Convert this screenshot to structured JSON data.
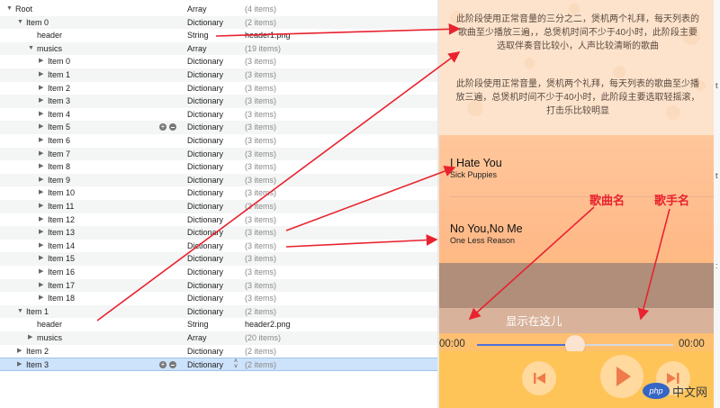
{
  "plist": {
    "rows": [
      {
        "key": "Root",
        "indent": 0,
        "disclosure": "open",
        "type": "Array",
        "value": "(4 items)"
      },
      {
        "key": "Item 0",
        "indent": 1,
        "disclosure": "open",
        "type": "Dictionary",
        "value": "(2 items)"
      },
      {
        "key": "header",
        "indent": 2,
        "disclosure": "none",
        "type": "String",
        "value": "header1.png"
      },
      {
        "key": "musics",
        "indent": 2,
        "disclosure": "open",
        "type": "Array",
        "value": "(19 items)"
      },
      {
        "key": "Item 0",
        "indent": 3,
        "disclosure": "closed",
        "type": "Dictionary",
        "value": "(3 items)"
      },
      {
        "key": "Item 1",
        "indent": 3,
        "disclosure": "closed",
        "type": "Dictionary",
        "value": "(3 items)"
      },
      {
        "key": "Item 2",
        "indent": 3,
        "disclosure": "closed",
        "type": "Dictionary",
        "value": "(3 items)"
      },
      {
        "key": "Item 3",
        "indent": 3,
        "disclosure": "closed",
        "type": "Dictionary",
        "value": "(3 items)"
      },
      {
        "key": "Item 4",
        "indent": 3,
        "disclosure": "closed",
        "type": "Dictionary",
        "value": "(3 items)"
      },
      {
        "key": "Item 5",
        "indent": 3,
        "disclosure": "closed",
        "type": "Dictionary",
        "value": "(3 items)",
        "controls": true
      },
      {
        "key": "Item 6",
        "indent": 3,
        "disclosure": "closed",
        "type": "Dictionary",
        "value": "(3 items)"
      },
      {
        "key": "Item 7",
        "indent": 3,
        "disclosure": "closed",
        "type": "Dictionary",
        "value": "(3 items)"
      },
      {
        "key": "Item 8",
        "indent": 3,
        "disclosure": "closed",
        "type": "Dictionary",
        "value": "(3 items)"
      },
      {
        "key": "Item 9",
        "indent": 3,
        "disclosure": "closed",
        "type": "Dictionary",
        "value": "(3 items)"
      },
      {
        "key": "Item 10",
        "indent": 3,
        "disclosure": "closed",
        "type": "Dictionary",
        "value": "(3 items)"
      },
      {
        "key": "Item 11",
        "indent": 3,
        "disclosure": "closed",
        "type": "Dictionary",
        "value": "(3 items)"
      },
      {
        "key": "Item 12",
        "indent": 3,
        "disclosure": "closed",
        "type": "Dictionary",
        "value": "(3 items)"
      },
      {
        "key": "Item 13",
        "indent": 3,
        "disclosure": "closed",
        "type": "Dictionary",
        "value": "(3 items)"
      },
      {
        "key": "Item 14",
        "indent": 3,
        "disclosure": "closed",
        "type": "Dictionary",
        "value": "(3 items)"
      },
      {
        "key": "Item 15",
        "indent": 3,
        "disclosure": "closed",
        "type": "Dictionary",
        "value": "(3 items)"
      },
      {
        "key": "Item 16",
        "indent": 3,
        "disclosure": "closed",
        "type": "Dictionary",
        "value": "(3 items)"
      },
      {
        "key": "Item 17",
        "indent": 3,
        "disclosure": "closed",
        "type": "Dictionary",
        "value": "(3 items)"
      },
      {
        "key": "Item 18",
        "indent": 3,
        "disclosure": "closed",
        "type": "Dictionary",
        "value": "(3 items)"
      },
      {
        "key": "Item 1",
        "indent": 1,
        "disclosure": "open",
        "type": "Dictionary",
        "value": "(2 items)"
      },
      {
        "key": "header",
        "indent": 2,
        "disclosure": "none",
        "type": "String",
        "value": "header2.png"
      },
      {
        "key": "musics",
        "indent": 2,
        "disclosure": "closed",
        "type": "Array",
        "value": "(20 items)"
      },
      {
        "key": "Item 2",
        "indent": 1,
        "disclosure": "closed",
        "type": "Dictionary",
        "value": "(2 items)"
      },
      {
        "key": "Item 3",
        "indent": 1,
        "disclosure": "closed",
        "type": "Dictionary",
        "value": "(2 items)",
        "controls": true,
        "selected": true
      }
    ]
  },
  "player": {
    "intro_paragraph_1": "此阶段使用正常音量的三分之二，煲机两个礼拜，每天列表的歌曲至少播放三遍，，总煲机时间不少于40小时，此阶段主要选取伴奏音比较小，人声比较清晰的歌曲",
    "intro_paragraph_2": "此阶段使用正常音量，煲机两个礼拜，每天列表的歌曲至少播放三遍，总煲机时间不少于40小时，此阶段主要选取轻摇滚，打击乐比较明显",
    "songs": [
      {
        "title": "I Hate You",
        "artist": "Sick Puppies"
      },
      {
        "title": "No You,No Me",
        "artist": "One Less Reason"
      }
    ],
    "lyric": "显示在这儿",
    "time_current": "00:00",
    "time_total": "00:00",
    "progress_fraction": 0.5,
    "buttons": {
      "prev_icon": "skip-back-icon",
      "play_icon": "play-icon",
      "next_icon": "skip-forward-icon"
    }
  },
  "annotations": {
    "song_name_label": "歌曲名",
    "singer_name_label": "歌手名"
  },
  "watermark": {
    "badge": "php",
    "text": "中文网"
  },
  "colors": {
    "annotation_red": "#e8232f",
    "selection_blue": "#cde2fb",
    "progress_blue": "#4f6fdc",
    "controls_orange": "#ffc458"
  }
}
